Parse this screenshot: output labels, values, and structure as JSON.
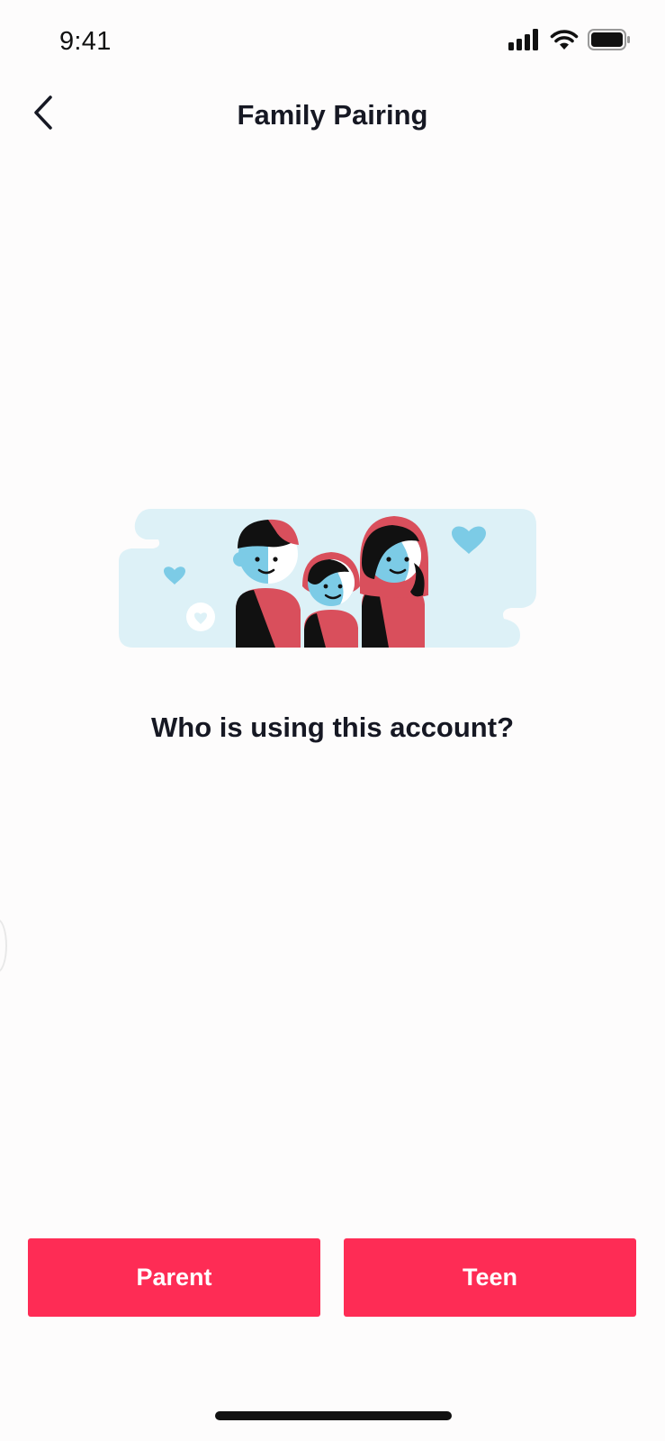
{
  "status_bar": {
    "time": "9:41",
    "icons": [
      "signal-icon",
      "wifi-icon",
      "battery-icon"
    ]
  },
  "nav": {
    "title": "Family Pairing",
    "back_icon": "chevron-left-icon"
  },
  "main": {
    "question": "Who is using this account?"
  },
  "buttons": {
    "parent_label": "Parent",
    "teen_label": "Teen"
  },
  "colors": {
    "accent": "#fe2c55",
    "illustration_bg": "#ddf1f7",
    "illustration_red": "#d94f5c",
    "illustration_blue": "#7ccbe6",
    "text": "#161823"
  }
}
